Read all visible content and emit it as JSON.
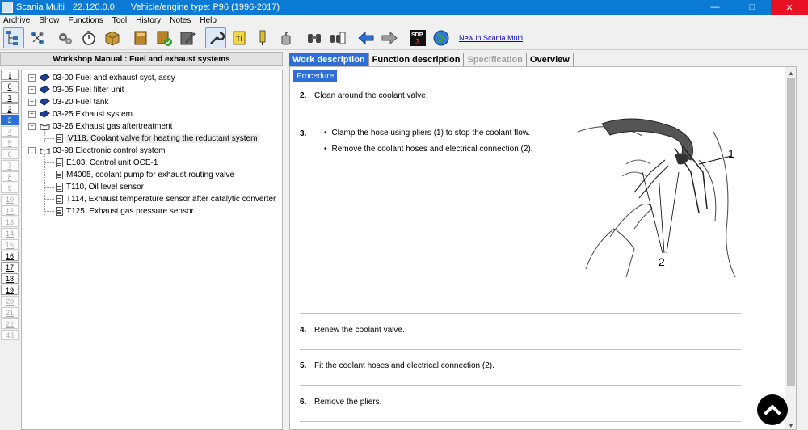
{
  "titlebar": {
    "app": "Scania Multi",
    "version": "22.120.0.0",
    "vehicle": "Vehicle/engine type: P96 (1996-2017)",
    "minimize": "—",
    "maximize": "□",
    "close": "✕"
  },
  "menu": [
    "Archive",
    "Show",
    "Functions",
    "Tool",
    "History",
    "Notes",
    "Help"
  ],
  "toolbar": {
    "new_link": "New in Scania Multi",
    "sdp_label": "SDP",
    "sdp_num": "3"
  },
  "left": {
    "header": "Workshop Manual : Fuel and exhaust systems",
    "levels": [
      {
        "label": "i",
        "state": "normal"
      },
      {
        "label": "0",
        "state": "normal"
      },
      {
        "label": "1",
        "state": "normal"
      },
      {
        "label": "2",
        "state": "normal"
      },
      {
        "label": "3",
        "state": "active"
      },
      {
        "label": "4",
        "state": "dim"
      },
      {
        "label": "5",
        "state": "dim"
      },
      {
        "label": "6",
        "state": "dim"
      },
      {
        "label": "7",
        "state": "dim"
      },
      {
        "label": "8",
        "state": "dim"
      },
      {
        "label": "9",
        "state": "dim"
      },
      {
        "label": "10",
        "state": "dim"
      },
      {
        "label": "12",
        "state": "dim"
      },
      {
        "label": "13",
        "state": "dim"
      },
      {
        "label": "14",
        "state": "dim"
      },
      {
        "label": "15",
        "state": "dim"
      },
      {
        "label": "16",
        "state": "normal"
      },
      {
        "label": "17",
        "state": "normal"
      },
      {
        "label": "18",
        "state": "normal"
      },
      {
        "label": "19",
        "state": "normal"
      },
      {
        "label": "20",
        "state": "dim"
      },
      {
        "label": "21",
        "state": "dim"
      },
      {
        "label": "22",
        "state": "dim"
      },
      {
        "label": "43",
        "state": "dim"
      }
    ],
    "tree": [
      {
        "label": "03-00 Fuel and exhaust syst, assy",
        "icon": "book-closed",
        "expander": "+"
      },
      {
        "label": "03-05 Fuel filter unit",
        "icon": "book-closed",
        "expander": "+"
      },
      {
        "label": "03-20 Fuel tank",
        "icon": "book-closed",
        "expander": "+"
      },
      {
        "label": "03-25 Exhaust system",
        "icon": "book-closed",
        "expander": "+"
      },
      {
        "label": "03-26 Exhaust gas aftertreatment",
        "icon": "book-open",
        "expander": "−"
      },
      {
        "label": "V118, Coolant valve for heating the reductant system",
        "icon": "document",
        "expander": ""
      },
      {
        "label": "03-98 Electronic control system",
        "icon": "book-open",
        "expander": "−"
      },
      {
        "label": "E103, Control unit OCE-1",
        "icon": "document",
        "expander": ""
      },
      {
        "label": "M4005, coolant pump for exhaust routing valve",
        "icon": "document",
        "expander": ""
      },
      {
        "label": "T110, Oil level sensor",
        "icon": "document",
        "expander": ""
      },
      {
        "label": "T114, Exhaust temperature sensor after catalytic converter",
        "icon": "document",
        "expander": ""
      },
      {
        "label": "T125, Exhaust gas pressure sensor",
        "icon": "document",
        "expander": ""
      }
    ]
  },
  "tabs": [
    "Work description",
    "Function description",
    "Specification",
    "Overview"
  ],
  "procedure_tab": "Procedure",
  "steps": {
    "s2": {
      "num": "2.",
      "text": "Clean around the coolant valve."
    },
    "s3": {
      "num": "3.",
      "bullets": [
        "Clamp the hose using pliers (1) to stop the coolant flow.",
        "Remove the coolant hoses and electrical connection (2)."
      ]
    },
    "s4": {
      "num": "4.",
      "text": "Renew the coolant valve."
    },
    "s5": {
      "num": "5.",
      "text": "Fit the coolant hoses and electrical connection (2)."
    },
    "s6": {
      "num": "6.",
      "text": "Remove the pliers."
    }
  },
  "figure": {
    "callout_1": "1",
    "callout_2": "2"
  }
}
